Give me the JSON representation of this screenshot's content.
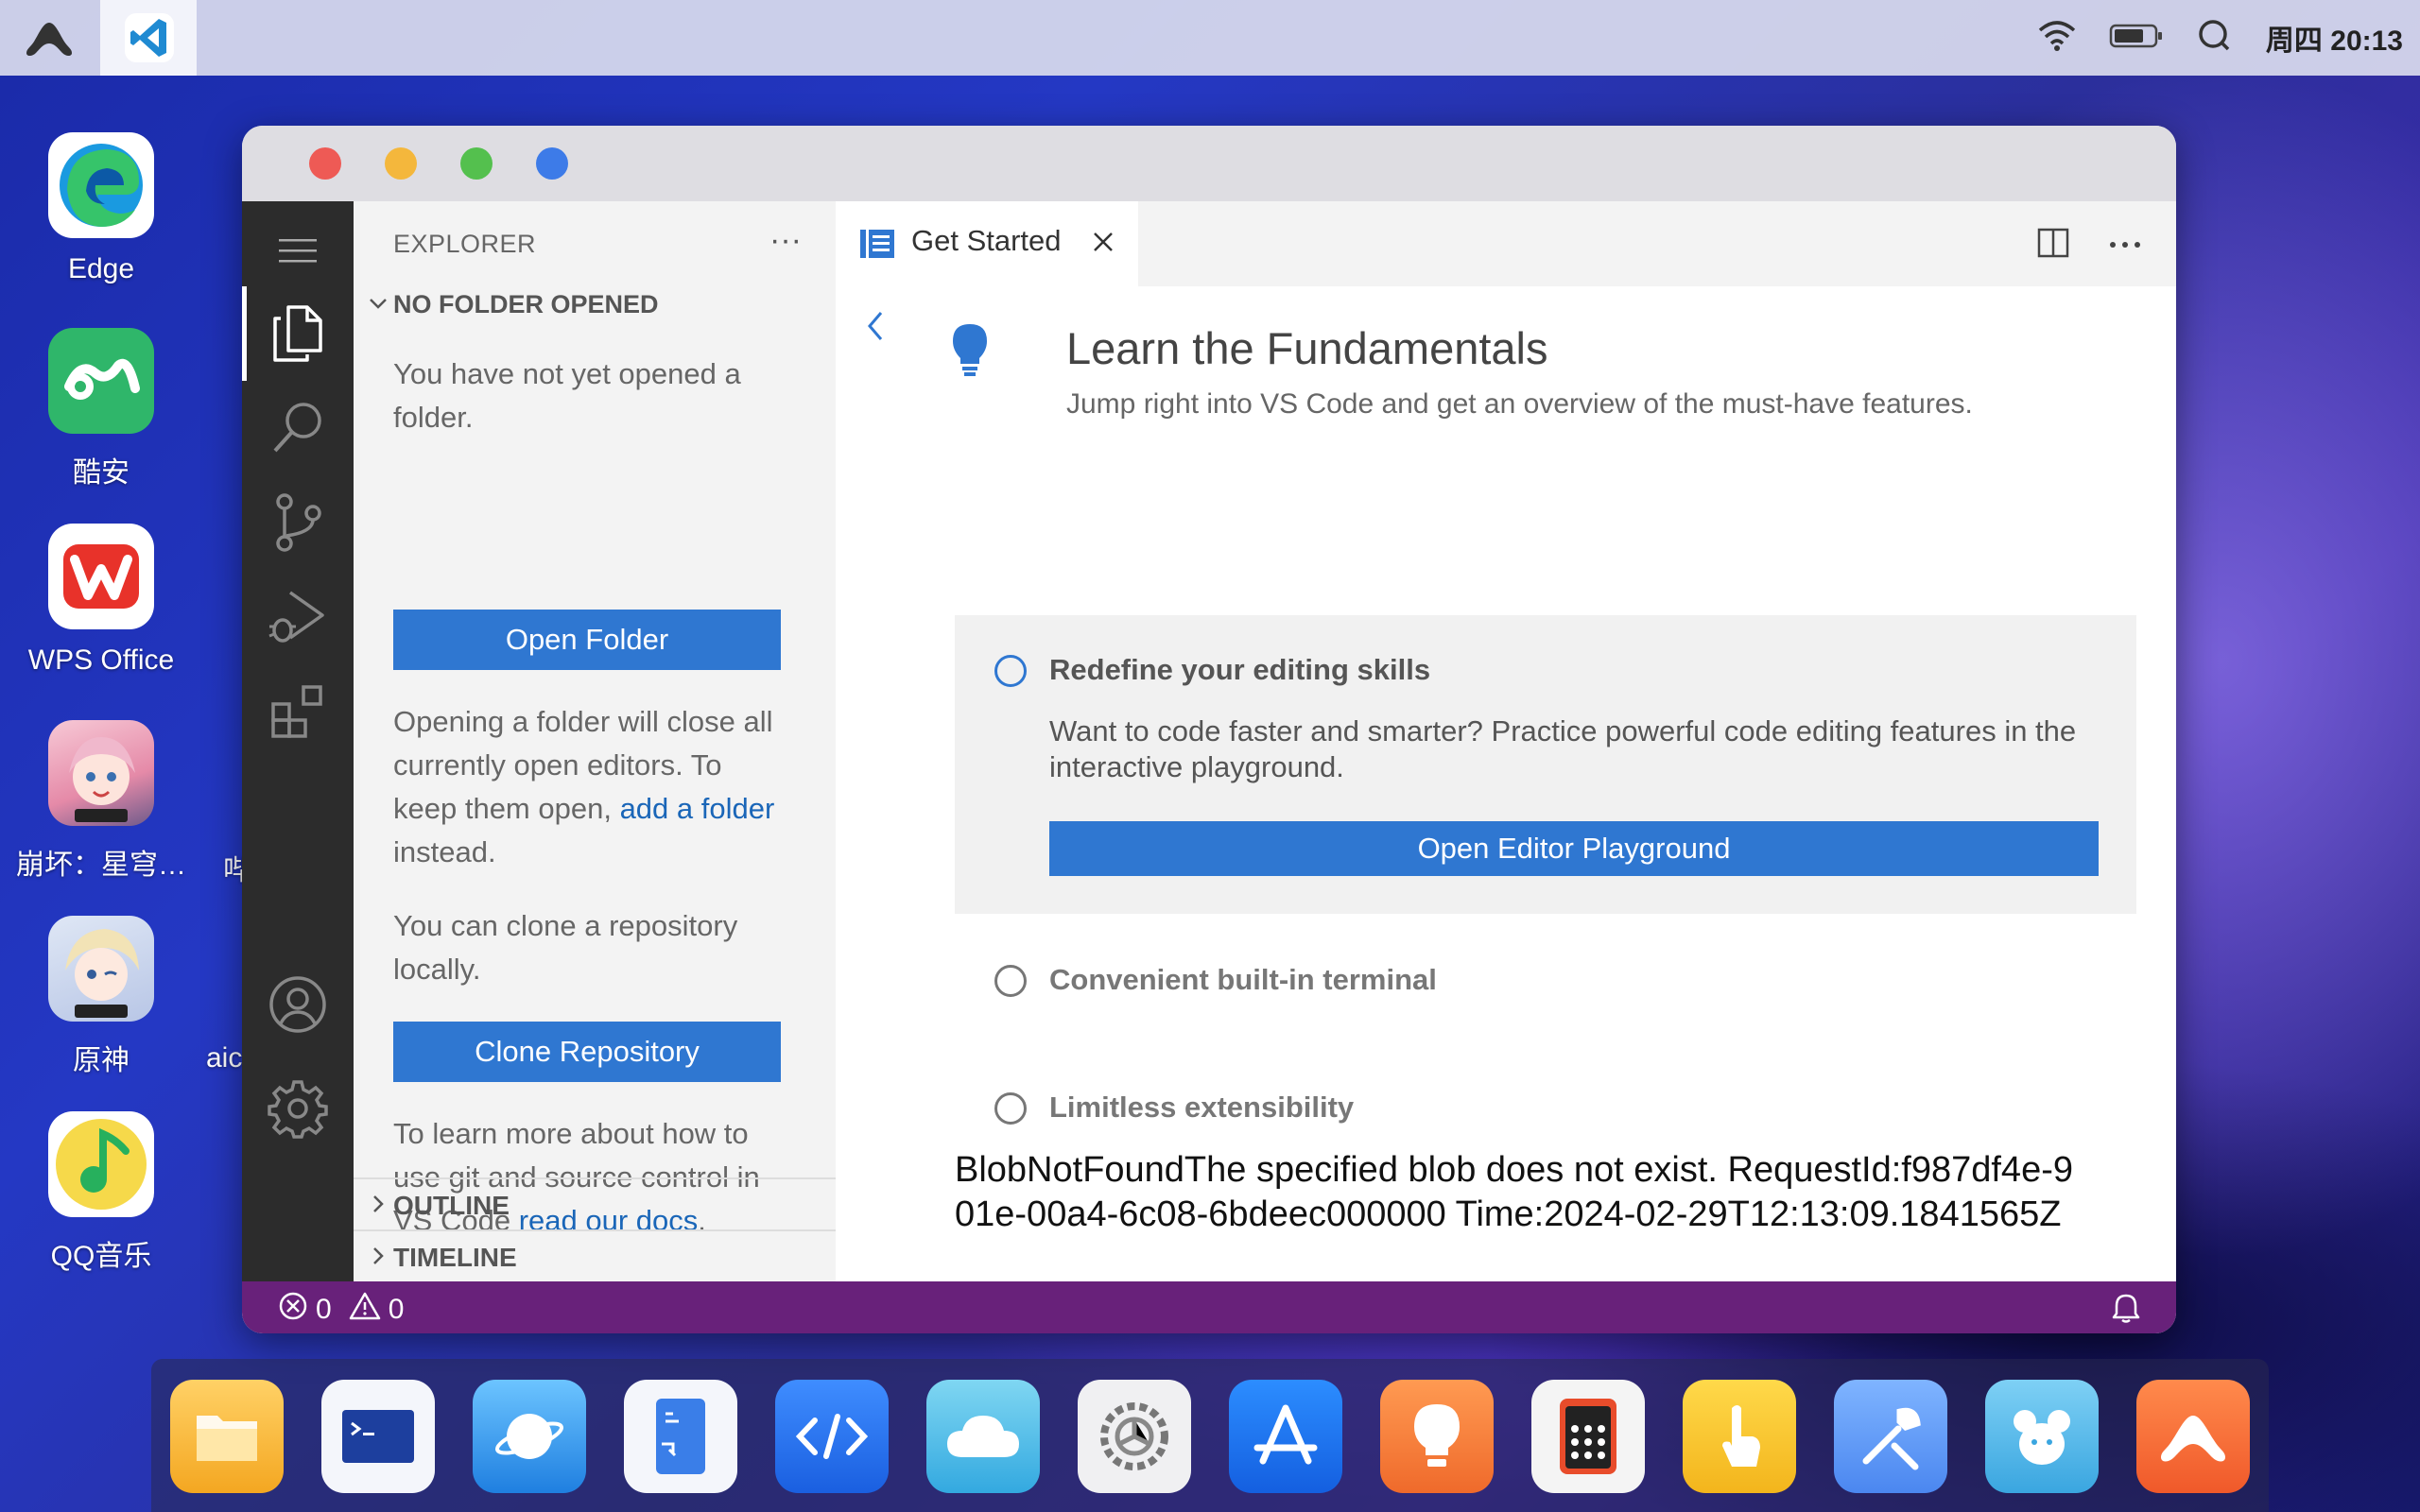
{
  "topbar": {
    "clock": "周四 20:13"
  },
  "desktop": {
    "icons": [
      {
        "label": "Edge"
      },
      {
        "label": "酷安"
      },
      {
        "label": "WPS Office"
      },
      {
        "label": "崩坏：星穹…"
      },
      {
        "label": "原神"
      },
      {
        "label": "QQ音乐"
      }
    ],
    "partial_labels": [
      "哔",
      "aic"
    ]
  },
  "vscode": {
    "activity_bar": [
      "explorer-icon",
      "search-icon",
      "source-control-icon",
      "run-debug-icon",
      "extensions-icon",
      "account-icon",
      "settings-gear-icon"
    ],
    "sidebar": {
      "header": "EXPLORER",
      "more": "···",
      "section_title": "NO FOLDER OPENED",
      "no_folder_text": "You have not yet opened a folder.",
      "open_folder_btn": "Open Folder",
      "closing_text_1": "Opening a folder will close all currently open editors. To keep them open, ",
      "add_folder_link": "add a folder",
      "closing_text_2": " instead.",
      "clone_text": "You can clone a repository locally.",
      "clone_btn": "Clone Repository",
      "learn_text_1": "To learn more about how to use git and source control in VS Code ",
      "read_docs_link": "read our docs",
      "learn_text_2": ".",
      "outline": "OUTLINE",
      "timeline": "TIMELINE"
    },
    "editor": {
      "tab_label": "Get Started",
      "title": "Learn the Fundamentals",
      "subtitle": "Jump right into VS Code and get an overview of the must-have features.",
      "steps": [
        {
          "title": "Redefine your editing skills",
          "description": "Want to code faster and smarter? Practice powerful code editing features in the interactive playground.",
          "button": "Open Editor Playground"
        },
        {
          "title": "Convenient built-in terminal"
        },
        {
          "title": "Limitless extensibility"
        }
      ],
      "error_text": "BlobNotFoundThe specified blob does not exist. RequestId:f987df4e-901e-00a4-6c08-6bdeec000000 Time:2024-02-29T12:13:09.1841565Z"
    },
    "statusbar": {
      "errors": "0",
      "warnings": "0"
    }
  },
  "dock": [
    "files",
    "terminal",
    "browser",
    "code-editor",
    "dev-tools",
    "cloud",
    "settings",
    "app-store",
    "tips",
    "calculator",
    "gestures",
    "dev-utilities",
    "mouse",
    "launcher"
  ],
  "colors": {
    "accent": "#2f77d1",
    "statusbar": "#68217a",
    "activitybar": "#2c2c2c"
  }
}
